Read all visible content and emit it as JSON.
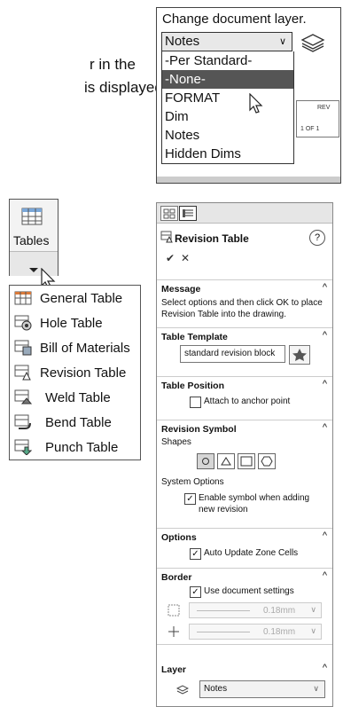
{
  "text_fragment": {
    "line1": "r in the",
    "line2": "is displayed."
  },
  "layer_popup": {
    "title": "Change document layer.",
    "selected": "Notes",
    "options": [
      "-Per Standard-",
      "-None-",
      "FORMAT",
      "Dim",
      "Notes",
      "Hidden Dims"
    ],
    "highlighted": "-None-",
    "bg_cells": [
      "REV",
      "1 OF 1"
    ]
  },
  "tables_menu": {
    "button_label": "Tables",
    "items": [
      {
        "label": "General Table",
        "icon": "general-table-icon"
      },
      {
        "label": "Hole Table",
        "icon": "hole-table-icon"
      },
      {
        "label": "Bill of Materials",
        "icon": "bom-icon"
      },
      {
        "label": "Revision Table",
        "icon": "revision-table-icon"
      },
      {
        "label": "Weld Table",
        "icon": "weld-table-icon"
      },
      {
        "label": "Bend Table",
        "icon": "bend-table-icon"
      },
      {
        "label": "Punch Table",
        "icon": "punch-table-icon"
      }
    ]
  },
  "property_manager": {
    "title": "Revision Table",
    "help": "?",
    "ok": "✔",
    "cancel": "✕",
    "message": {
      "header": "Message",
      "text": "Select options and then click OK to place Revision Table into the drawing."
    },
    "template": {
      "header": "Table Template",
      "value": "standard revision block"
    },
    "position": {
      "header": "Table Position",
      "checkbox": "Attach to anchor point",
      "checked": false
    },
    "symbol": {
      "header": "Revision Symbol",
      "shapes_label": "Shapes",
      "system_label": "System Options",
      "enable_label": "Enable symbol when adding new revision",
      "enable_checked": true
    },
    "options": {
      "header": "Options",
      "checkbox": "Auto Update Zone Cells",
      "checked": true
    },
    "border": {
      "header": "Border",
      "use_doc": "Use document settings",
      "use_doc_checked": true,
      "box_value": "0.18mm",
      "grid_value": "0.18mm"
    },
    "layer": {
      "header": "Layer",
      "value": "Notes"
    },
    "collapse_glyph": "^"
  },
  "colors": {
    "highlight": "#555555",
    "section_rule": "#cccccc",
    "panel_toolbar": "#e6e6e6"
  }
}
